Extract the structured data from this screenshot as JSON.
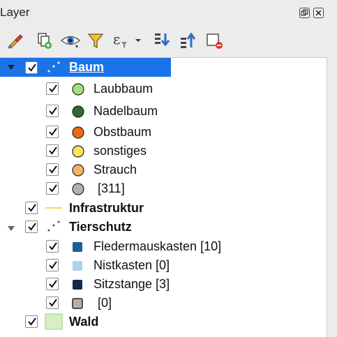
{
  "panel": {
    "title": "Layer",
    "restore_icon": "float-restore-icon",
    "close_icon": "close-icon"
  },
  "toolbar": {
    "icons": [
      "style-brush-icon",
      "add-group-icon",
      "eye-visibility-icon",
      "filter-legend-icon",
      "expression-filter-icon",
      "expand-all-icon",
      "collapse-all-icon",
      "remove-layer-icon"
    ]
  },
  "colors": {
    "selection": "#1a73e8",
    "laubbaum": "#a6e07a",
    "nadelbaum": "#2e6a2b",
    "obstbaum": "#f06a14",
    "sonstiges": "#f6e65a",
    "strauch": "#f4b36b",
    "unclassified": "#b8aeb0",
    "infrastruktur": "#f2e04a",
    "fledermauskasten": "#1f5c99",
    "nistkasten": "#a9d3ea",
    "sitzstange": "#0f2c4a",
    "wald_fill": "#d6f0c4"
  },
  "layers": {
    "baum": {
      "name": "Baum",
      "checked": true,
      "expanded": true,
      "classes": [
        {
          "label": "Laubbaum",
          "checked": true
        },
        {
          "label": "Nadelbaum",
          "checked": true
        },
        {
          "label": "Obstbaum",
          "checked": true
        },
        {
          "label": "sonstiges",
          "checked": true
        },
        {
          "label": "Strauch",
          "checked": true
        },
        {
          "label": "[311]",
          "checked": true
        }
      ]
    },
    "infrastruktur": {
      "name": "Infrastruktur",
      "checked": true
    },
    "tierschutz": {
      "name": "Tierschutz",
      "checked": true,
      "expanded": true,
      "classes": [
        {
          "label": "Fledermauskasten [10]",
          "checked": true
        },
        {
          "label": "Nistkasten [0]",
          "checked": true
        },
        {
          "label": "Sitzstange [3]",
          "checked": true
        },
        {
          "label": "[0]",
          "checked": true
        }
      ]
    },
    "wald": {
      "name": "Wald",
      "checked": true
    }
  }
}
